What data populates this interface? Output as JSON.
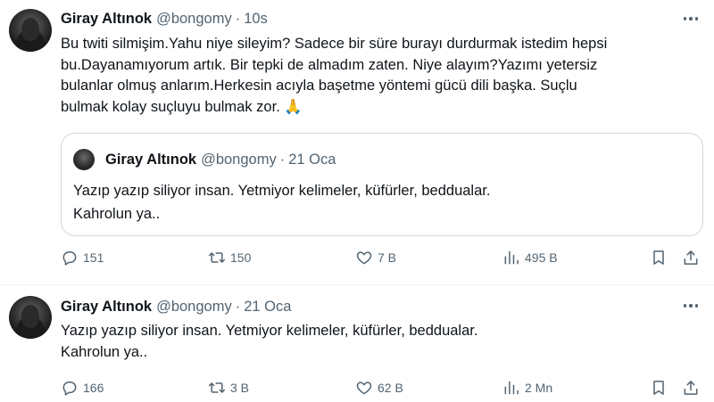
{
  "tweets": [
    {
      "author_name": "Giray Altınok",
      "author_handle": "@bongomy",
      "separator": "·",
      "time": "10s",
      "text": "Bu twiti silmişim.Yahu niye sileyim? Sadece bir süre burayı durdurmak istedim hepsi\nbu.Dayanamıyorum artık. Bir tepki de almadım zaten. Niye alayım?Yazımı yetersiz\nbulanlar olmuş anlarım.Herkesin acıyla başetme yöntemi gücü dili başka. Suçlu\nbulmak kolay suçluyu bulmak zor. 🙏",
      "quoted": {
        "author_name": "Giray Altınok",
        "author_handle": "@bongomy",
        "separator": "·",
        "time": "21 Oca",
        "text": "Yazıp yazıp siliyor insan. Yetmiyor kelimeler, küfürler, beddualar.\nKahrolun ya.."
      },
      "stats": {
        "replies": "151",
        "retweets": "150",
        "likes": "7 B",
        "views": "495 B"
      }
    },
    {
      "author_name": "Giray Altınok",
      "author_handle": "@bongomy",
      "separator": "·",
      "time": "21 Oca",
      "text": "Yazıp yazıp siliyor insan. Yetmiyor kelimeler, küfürler, beddualar.\nKahrolun ya..",
      "stats": {
        "replies": "166",
        "retweets": "3 B",
        "likes": "62 B",
        "views": "2 Mn"
      }
    }
  ],
  "icons": {
    "reply": "reply-icon",
    "retweet": "retweet-icon",
    "like": "heart-icon",
    "views": "views-chart-icon",
    "bookmark": "bookmark-icon",
    "share": "share-icon",
    "more": "more-dots-icon"
  },
  "colors": {
    "primary_text": "#0f1419",
    "secondary_text": "#536471",
    "border": "#cfd9de"
  }
}
